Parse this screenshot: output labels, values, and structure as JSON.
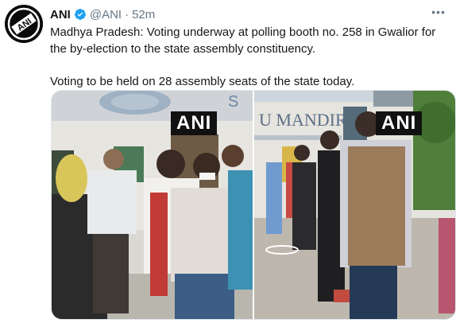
{
  "tweet": {
    "author_name": "ANI",
    "author_handle": "@ANI",
    "separator": "·",
    "time": "52m",
    "more_glyph": "•••",
    "text_line1": "Madhya Pradesh: Voting underway at polling booth no. 258 in Gwalior for the by-election to the state assembly constituency.",
    "text_line2": "Voting to be held on 28 assembly seats of the state today.",
    "avatar_text": "ANI",
    "verified_icon": "verified-badge-icon",
    "accent_color": "#1da1f2"
  },
  "media": {
    "left_watermark": "ANI",
    "right_watermark": "ANI",
    "left_sign": "S",
    "right_sign": "U MANDIR"
  }
}
